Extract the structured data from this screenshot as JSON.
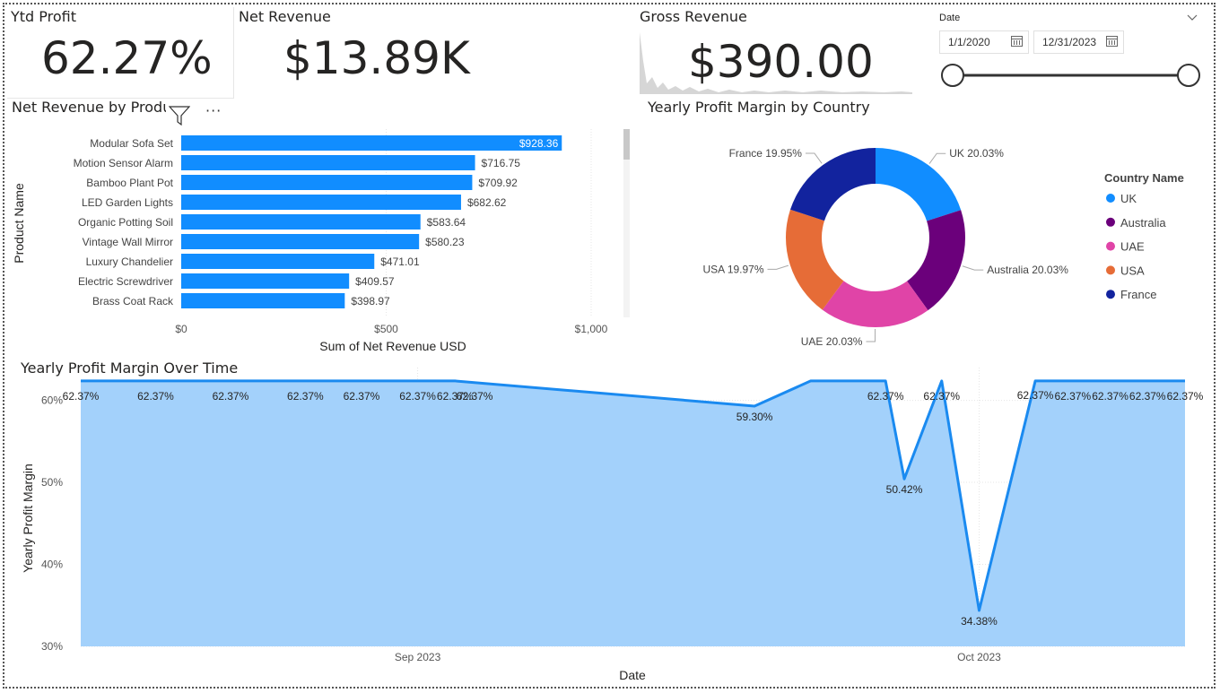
{
  "kpis": {
    "ytd_profit": {
      "title": "Ytd Profit",
      "value": "62.27%"
    },
    "net_revenue": {
      "title": "Net Revenue",
      "value": "$13.89K"
    },
    "gross_revenue": {
      "title": "Gross Revenue",
      "value": "$390.00"
    }
  },
  "slicer": {
    "label": "Date",
    "start": "1/1/2020",
    "end": "12/31/2023",
    "range_fraction": [
      0,
      1
    ]
  },
  "colors": {
    "bar": "#118DFF",
    "area_fill": "#A3D1FB",
    "line": "#1A8AF0",
    "grid": "#E6E6E6"
  },
  "icons": [
    "filter-icon",
    "more-options-icon",
    "calendar-icon",
    "chevron-down-icon"
  ],
  "chart_data": [
    {
      "type": "bar",
      "orientation": "horizontal",
      "title": "Net Revenue by Produ",
      "ylabel": "Product Name",
      "xlabel": "Sum of Net Revenue USD",
      "categories": [
        "Modular Sofa Set",
        "Motion Sensor Alarm",
        "Bamboo Plant Pot",
        "LED Garden Lights",
        "Organic Potting Soil",
        "Vintage Wall Mirror",
        "Luxury Chandelier",
        "Electric Screwdriver",
        "Brass Coat Rack"
      ],
      "values": [
        928.36,
        716.75,
        709.92,
        682.62,
        583.64,
        580.23,
        471.01,
        409.57,
        398.97
      ],
      "data_labels": [
        "$928.36",
        "$716.75",
        "$709.92",
        "$682.62",
        "$583.64",
        "$580.23",
        "$471.01",
        "$409.57",
        "$398.97"
      ],
      "xlim": [
        0,
        1000
      ],
      "xticks": [
        0,
        500,
        1000
      ],
      "xtick_labels": [
        "$0",
        "$500",
        "$1,000"
      ]
    },
    {
      "type": "pie",
      "subtype": "donut",
      "title": "Yearly Profit Margin by Country",
      "legend_title": "Country Name",
      "legend_position": "right",
      "labels": [
        "UK",
        "Australia",
        "UAE",
        "USA",
        "France"
      ],
      "values": [
        20.03,
        20.03,
        20.03,
        19.97,
        19.95
      ],
      "data_labels": [
        "UK 20.03%",
        "Australia 20.03%",
        "UAE 20.03%",
        "USA 19.97%",
        "France 19.95%"
      ],
      "colors": [
        "#118DFF",
        "#6B007B",
        "#E044A7",
        "#E66C37",
        "#12239E"
      ]
    },
    {
      "type": "area",
      "title": "Yearly Profit Margin Over Time",
      "xlabel": "Date",
      "ylabel": "Yearly Profit Margin",
      "ylim": [
        30,
        64
      ],
      "yticks": [
        30,
        40,
        50,
        60
      ],
      "ytick_labels": [
        "30%",
        "40%",
        "50%",
        "60%"
      ],
      "xticks": [
        "2023-09-01",
        "2023-10-01"
      ],
      "xtick_labels": [
        "Sep 2023",
        "Oct 2023"
      ],
      "x": [
        "2023-08-14",
        "2023-08-16",
        "2023-08-18",
        "2023-08-20",
        "2023-08-22",
        "2023-08-24",
        "2023-08-26",
        "2023-08-27",
        "2023-08-29",
        "2023-09-01",
        "2023-09-03",
        "2023-09-19",
        "2023-09-22",
        "2023-09-26",
        "2023-09-27",
        "2023-09-29",
        "2023-10-01",
        "2023-10-04",
        "2023-10-06",
        "2023-10-08",
        "2023-10-10",
        "2023-10-12"
      ],
      "y": [
        62.37,
        62.37,
        62.37,
        62.37,
        62.37,
        62.37,
        62.37,
        62.37,
        62.37,
        62.37,
        62.37,
        59.3,
        62.37,
        62.37,
        50.42,
        62.37,
        34.38,
        62.37,
        62.37,
        62.37,
        62.37,
        62.37
      ],
      "shown_labels": [
        {
          "i": 0,
          "text": "62.37%"
        },
        {
          "i": 2,
          "text": "62.37%"
        },
        {
          "i": 4,
          "text": "62.37%"
        },
        {
          "i": 6,
          "text": "62.37%"
        },
        {
          "i": 8,
          "text": "62.37%"
        },
        {
          "i": 9,
          "text": "62.37%"
        },
        {
          "i": 10,
          "text": "62.37%"
        },
        {
          "i": 11,
          "text": "62.37%"
        },
        {
          "i": 11,
          "text": "59.30%"
        },
        {
          "i": 13,
          "text": "62.37%"
        },
        {
          "i": 14,
          "text": "50.42%"
        },
        {
          "i": 15,
          "text": "62.37%"
        },
        {
          "i": 16,
          "text": "34.38%"
        },
        {
          "i": 17,
          "text": "62.37%"
        },
        {
          "i": 18,
          "text": "62.37%"
        },
        {
          "i": 19,
          "text": "62.37%"
        },
        {
          "i": 20,
          "text": "62.37%"
        },
        {
          "i": 21,
          "text": "62.37%"
        }
      ]
    }
  ]
}
